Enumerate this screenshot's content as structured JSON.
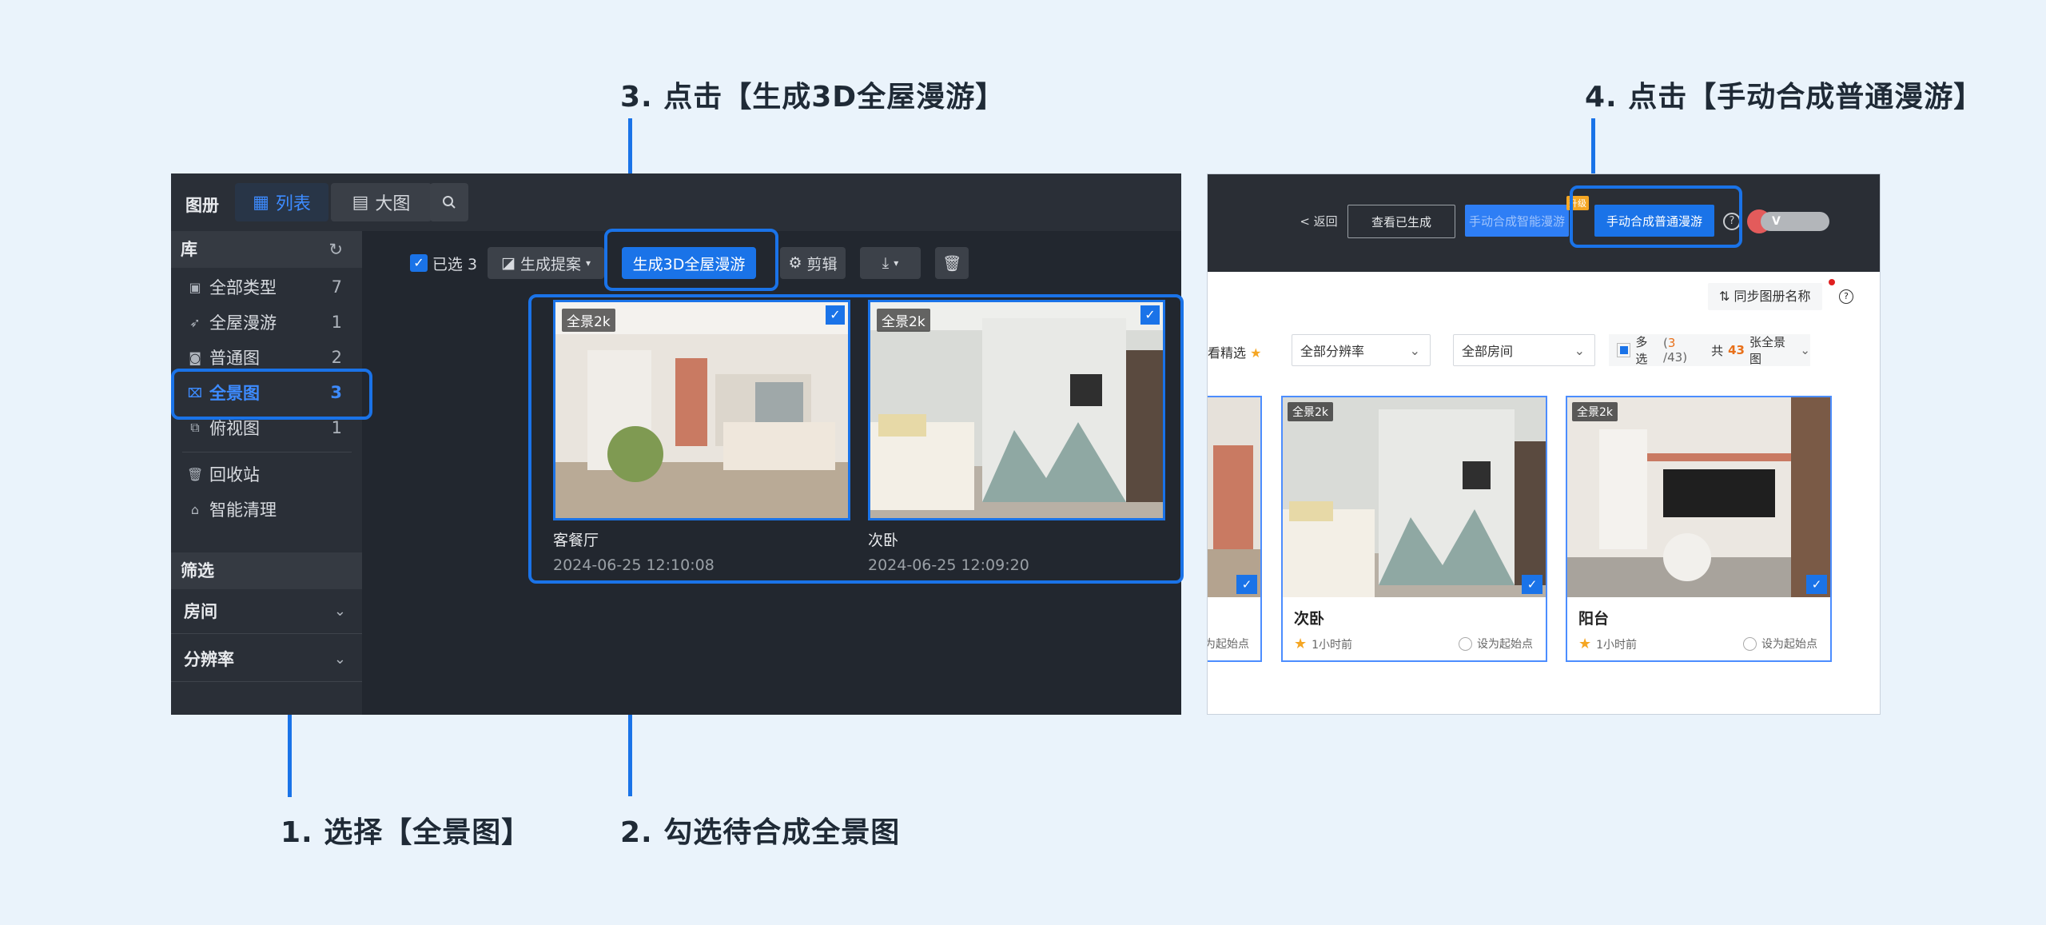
{
  "captions": {
    "step1": "1. 选择【全景图】",
    "step2": "2. 勾选待合成全景图",
    "step3": "3. 点击【生成3D全屋漫游】",
    "step4": "4. 点击【手动合成普通漫游】"
  },
  "colors": {
    "accent": "#1a73e8",
    "dark_bg": "#22272f",
    "page_bg": "#eaf3fb"
  },
  "left_app": {
    "title": "图册",
    "view_tabs": [
      {
        "label": "列表",
        "icon": "grid-icon",
        "active": true
      },
      {
        "label": "大图",
        "icon": "list-icon",
        "active": false
      }
    ],
    "library": {
      "heading": "库",
      "items": [
        {
          "label": "全部类型",
          "count": "7",
          "icon": "images-icon"
        },
        {
          "label": "全屋漫游",
          "count": "1",
          "icon": "rocket-icon"
        },
        {
          "label": "普通图",
          "count": "2",
          "icon": "camera-icon"
        },
        {
          "label": "全景图",
          "count": "3",
          "icon": "panorama-icon",
          "active": true
        },
        {
          "label": "俯视图",
          "count": "1",
          "icon": "topview-icon"
        }
      ],
      "extra": [
        {
          "label": "回收站",
          "icon": "trash-icon"
        },
        {
          "label": "智能清理",
          "icon": "broom-icon"
        }
      ]
    },
    "filter": {
      "heading": "筛选",
      "rows": [
        "房间",
        "分辨率"
      ]
    },
    "toolbar": {
      "selected": "已选 3",
      "proposal": "生成提案",
      "generate_3d": "生成3D全屋漫游",
      "edit": "剪辑"
    },
    "cards": [
      {
        "tag": "全景2k",
        "name": "客餐厅",
        "date": "2024-06-25 12:10:08"
      },
      {
        "tag": "全景2k",
        "name": "次卧",
        "date": "2024-06-25 12:09:20"
      }
    ]
  },
  "right_app": {
    "back": "< 返回",
    "view_generated": "查看已生成",
    "smart_roam": "手动合成智能漫游",
    "upgrade_badge": "升级",
    "normal_roam": "手动合成普通漫游",
    "sync_names": "同步图册名称",
    "featured": "看精选",
    "resolution_select": "全部分辨率",
    "room_select": "全部房间",
    "multi_select": "多选",
    "selected_count": "3",
    "total_count": "/43)",
    "total_prefix": "共",
    "total_num": "43",
    "total_suffix": "张全景图",
    "cards": [
      {
        "tag": "全景2k",
        "name": "次卧",
        "time": "1小时前",
        "start": "设为起始点"
      },
      {
        "tag": "全景2k",
        "name": "阳台",
        "time": "1小时前",
        "start": "设为起始点"
      }
    ],
    "partial_card_start": "为起始点"
  }
}
